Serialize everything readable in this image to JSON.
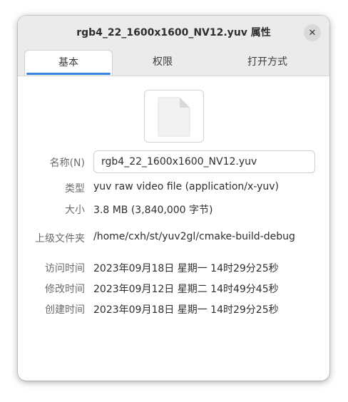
{
  "window": {
    "title": "rgb4_22_1600x1600_NV12.yuv 属性",
    "close_glyph": "✕"
  },
  "tabs": [
    {
      "label": "基本",
      "active": true
    },
    {
      "label": "权限",
      "active": false
    },
    {
      "label": "打开方式",
      "active": false
    }
  ],
  "file_icon": "generic-file-icon",
  "properties": {
    "name_label": "名称(N)",
    "name_value": "rgb4_22_1600x1600_NV12.yuv",
    "type_label": "类型",
    "type_value": "yuv raw video file (application/x-yuv)",
    "size_label": "大小",
    "size_value": "3.8 MB (3,840,000 字节)",
    "parent_label": "上级文件夹",
    "parent_value": "/home/cxh/st/yuv2gl/cmake-build-debug",
    "accessed_label": "访问时间",
    "accessed_value": "2023年09月18日 星期一 14时29分25秒",
    "modified_label": "修改时间",
    "modified_value": "2023年09月12日 星期二 14时49分45秒",
    "created_label": "创建时间",
    "created_value": "2023年09月18日 星期一 14时29分25秒"
  },
  "colors": {
    "accent": "#3584e4",
    "titlebar_bg": "#ebebeb"
  }
}
